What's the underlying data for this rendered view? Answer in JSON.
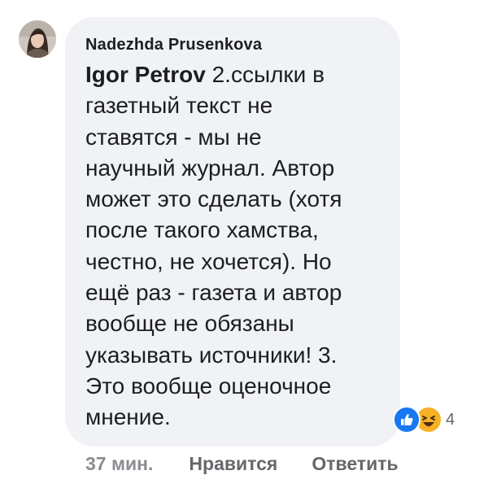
{
  "comment": {
    "author": "Nadezhda Prusenkova",
    "mention": "Igor Petrov",
    "text_lines": [
      " 2.ссылки в",
      "газетный текст не",
      "ставятся - мы не",
      "научный журнал. Автор",
      "может это сделать (хотя",
      "после такого хамства,",
      "честно, не хочется). Но",
      "ещё раз - газета и автор",
      "вообще не обязаны",
      "указывать источники! 3.",
      "Это вообще оценочное",
      "мнение."
    ],
    "reactions": {
      "icons": [
        "like-icon",
        "haha-icon"
      ],
      "count": "4",
      "colors": {
        "like": "#1877f2",
        "haha": "#f7b125"
      }
    }
  },
  "actions": {
    "time": "37 мин.",
    "like_label": "Нравится",
    "reply_label": "Ответить"
  },
  "colors": {
    "bubble_bg": "#f0f2f5",
    "text": "#1c1e21",
    "secondary_text": "#65676b"
  }
}
